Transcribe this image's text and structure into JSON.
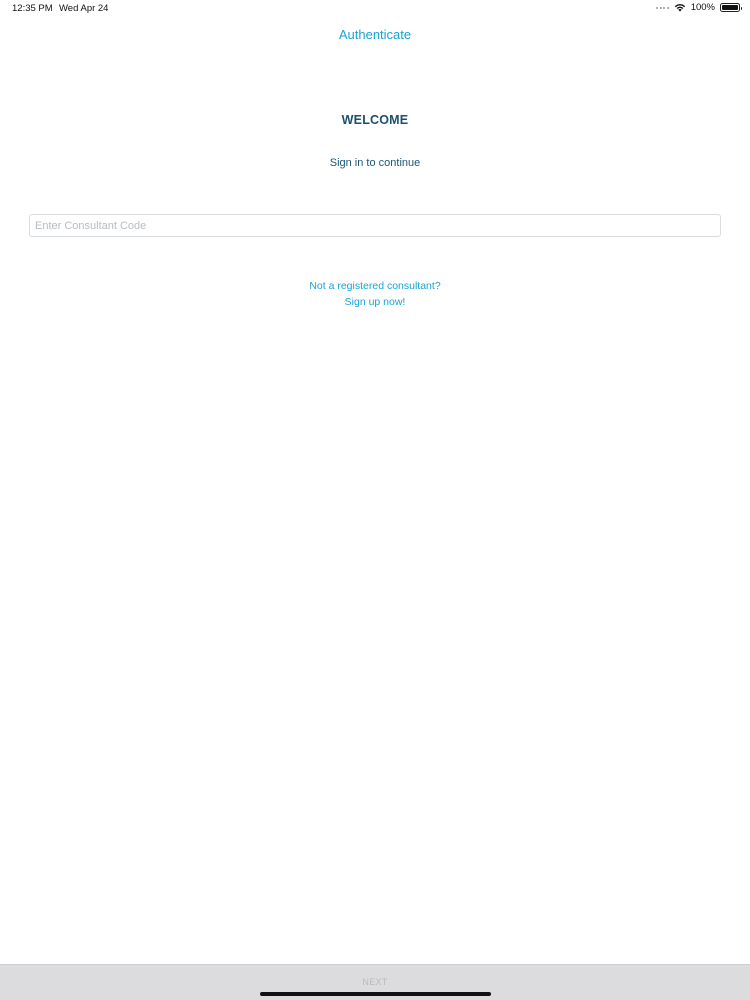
{
  "status_bar": {
    "time": "12:35 PM",
    "date": "Wed Apr 24",
    "battery_text": "100%",
    "battery_level": 1.0,
    "icons": [
      "signal-dots-icon",
      "wifi-icon",
      "battery-icon"
    ]
  },
  "nav": {
    "title": "Authenticate"
  },
  "main": {
    "welcome": "WELCOME",
    "subtitle": "Sign in to continue",
    "consultant_code": {
      "value": "",
      "placeholder": "Enter Consultant Code"
    },
    "register_prompt": "Not a registered consultant?",
    "signup_link": "Sign up now!"
  },
  "bottom_bar": {
    "next_label": "NEXT"
  },
  "colors": {
    "accent": "#1aa3d6",
    "heading": "#1b4f6e",
    "bottom_bar": "#dcdcdf",
    "disabled_text": "#b9b9bc"
  }
}
